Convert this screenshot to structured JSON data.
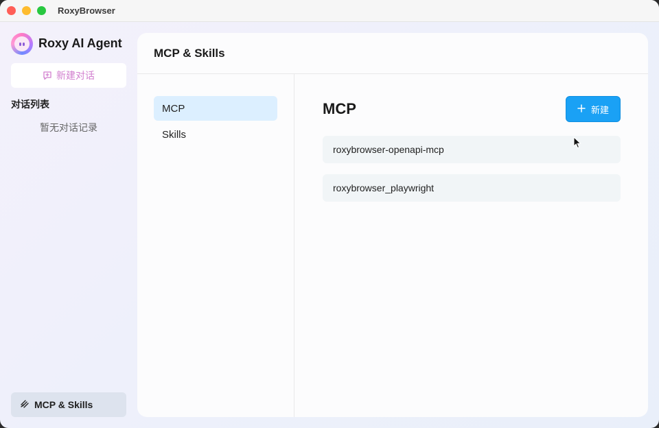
{
  "window": {
    "app_title": "RoxyBrowser"
  },
  "sidebar": {
    "brand_name": "Roxy AI Agent",
    "new_chat_label": "新建对话",
    "conversation_list_title": "对话列表",
    "empty_text": "暂无对话记录",
    "mcp_skills_label": "MCP & Skills"
  },
  "panel": {
    "title": "MCP & Skills",
    "nav": [
      {
        "label": "MCP",
        "active": true
      },
      {
        "label": "Skills",
        "active": false
      }
    ],
    "content_title": "MCP",
    "add_button_label": "新建",
    "servers": [
      {
        "name": "roxybrowser-openapi-mcp"
      },
      {
        "name": "roxybrowser_playwright"
      }
    ]
  },
  "colors": {
    "accent": "#1aa1f5",
    "nav_active_bg": "#dcefff",
    "new_chat_text": "#d27fcf"
  },
  "icons": [
    "chat-plus-icon",
    "layers-icon",
    "plus-icon",
    "mouse-cursor-icon"
  ]
}
